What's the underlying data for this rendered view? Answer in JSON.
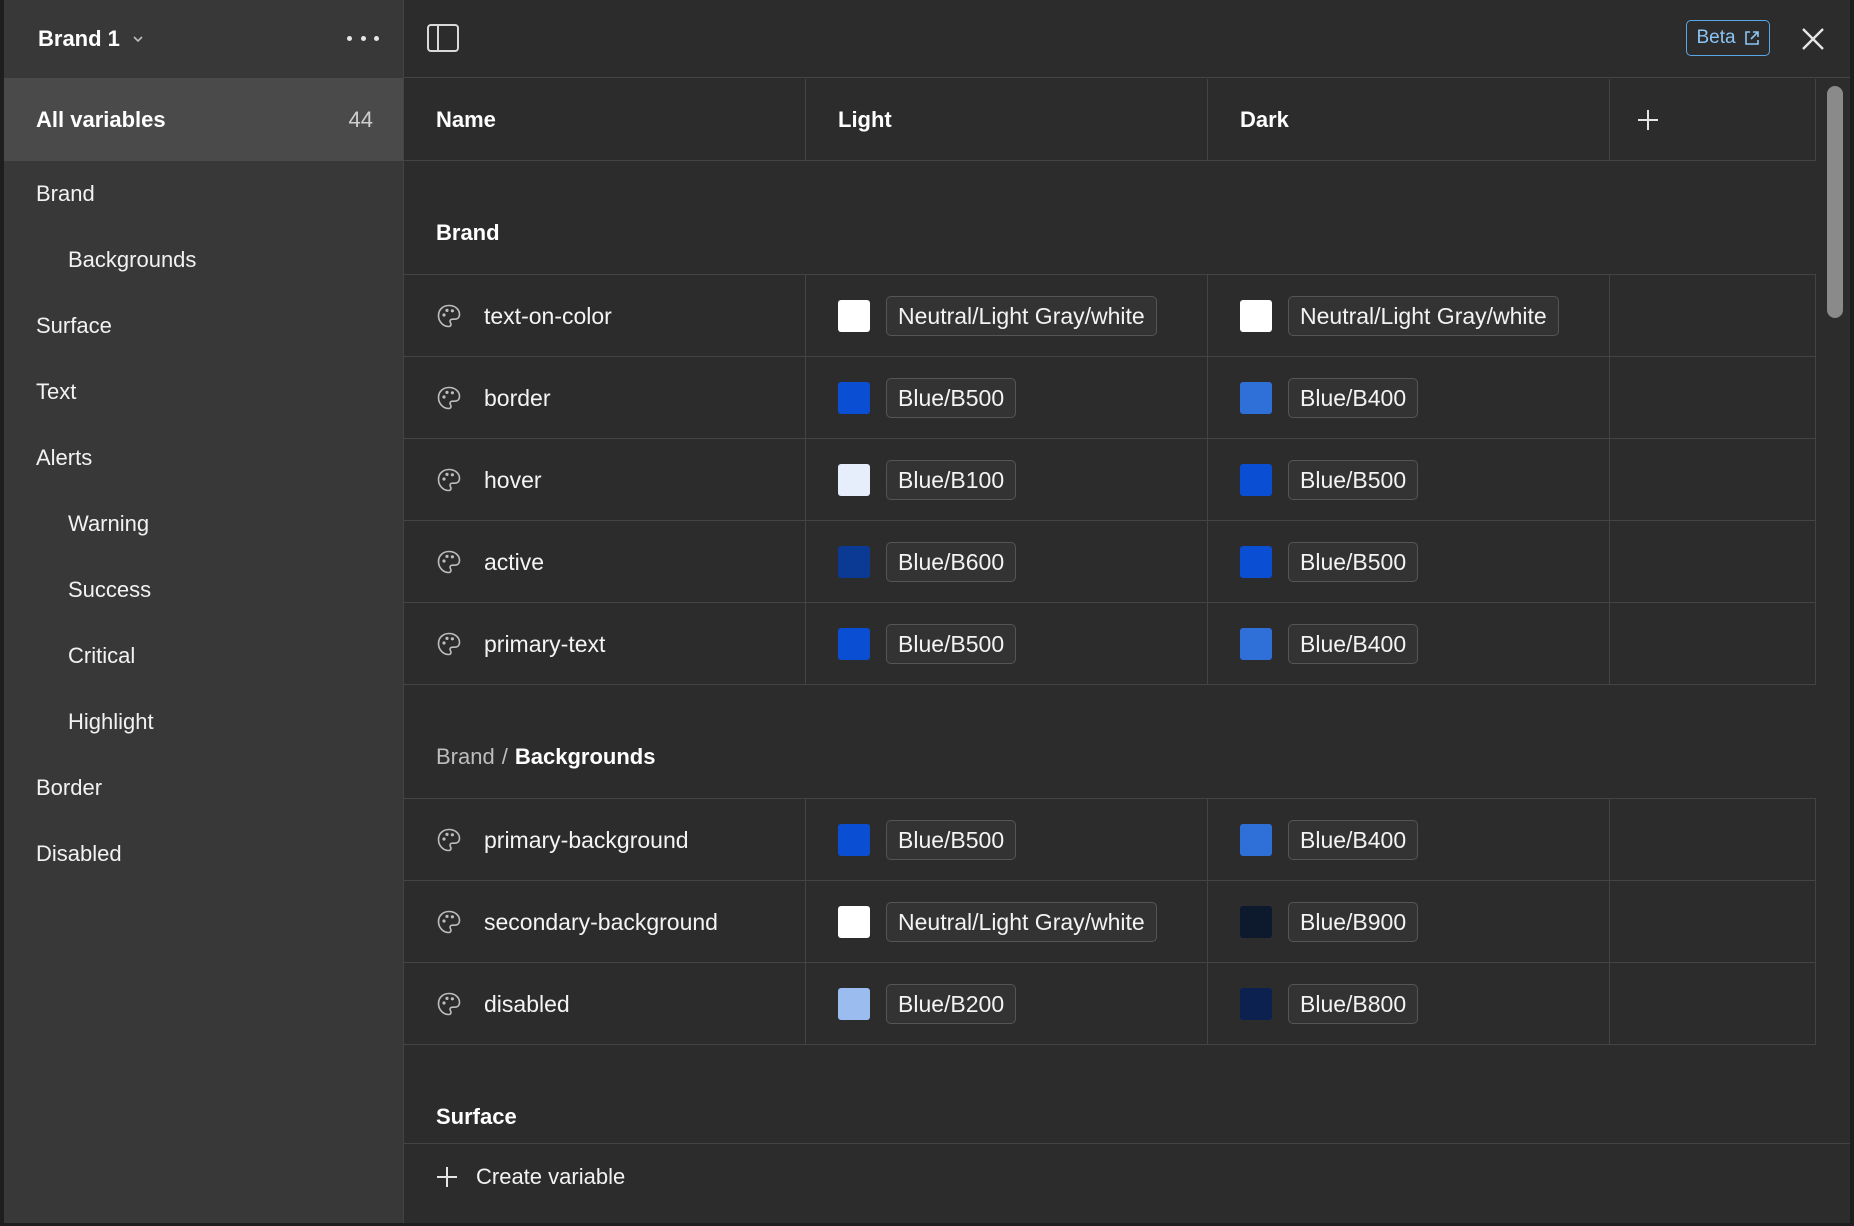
{
  "sidebar": {
    "collection_name": "Brand 1",
    "all_variables": {
      "label": "All variables",
      "count": "44"
    },
    "groups": [
      {
        "label": "Brand",
        "level": 0
      },
      {
        "label": "Backgrounds",
        "level": 1
      },
      {
        "label": "Surface",
        "level": 0
      },
      {
        "label": "Text",
        "level": 0
      },
      {
        "label": "Alerts",
        "level": 0
      },
      {
        "label": "Warning",
        "level": 1
      },
      {
        "label": "Success",
        "level": 1
      },
      {
        "label": "Critical",
        "level": 1
      },
      {
        "label": "Highlight",
        "level": 1
      },
      {
        "label": "Border",
        "level": 0
      },
      {
        "label": "Disabled",
        "level": 0
      }
    ]
  },
  "topbar": {
    "beta_label": "Beta"
  },
  "table": {
    "columns": {
      "name": "Name",
      "light": "Light",
      "dark": "Dark"
    },
    "groups": [
      {
        "parent": "",
        "title": "Brand",
        "rows": [
          {
            "name": "text-on-color",
            "light": {
              "value": "Neutral/Light Gray/white",
              "color": "#ffffff"
            },
            "dark": {
              "value": "Neutral/Light Gray/white",
              "color": "#ffffff"
            }
          },
          {
            "name": "border",
            "light": {
              "value": "Blue/B500",
              "color": "#0a4fd3"
            },
            "dark": {
              "value": "Blue/B400",
              "color": "#2e6fd8"
            }
          },
          {
            "name": "hover",
            "light": {
              "value": "Blue/B100",
              "color": "#e6edfb"
            },
            "dark": {
              "value": "Blue/B500",
              "color": "#0a4fd3"
            }
          },
          {
            "name": "active",
            "light": {
              "value": "Blue/B600",
              "color": "#0b3a94"
            },
            "dark": {
              "value": "Blue/B500",
              "color": "#0a4fd3"
            }
          },
          {
            "name": "primary-text",
            "light": {
              "value": "Blue/B500",
              "color": "#0a4fd3"
            },
            "dark": {
              "value": "Blue/B400",
              "color": "#2e6fd8"
            }
          }
        ]
      },
      {
        "parent": "Brand",
        "separator": "/",
        "title": "Backgrounds",
        "rows": [
          {
            "name": "primary-background",
            "light": {
              "value": "Blue/B500",
              "color": "#0a4fd3"
            },
            "dark": {
              "value": "Blue/B400",
              "color": "#2e6fd8"
            }
          },
          {
            "name": "secondary-background",
            "light": {
              "value": "Neutral/Light Gray/white",
              "color": "#ffffff"
            },
            "dark": {
              "value": "Blue/B900",
              "color": "#0d1a2e"
            }
          },
          {
            "name": "disabled",
            "light": {
              "value": "Blue/B200",
              "color": "#9bbcef"
            },
            "dark": {
              "value": "Blue/B800",
              "color": "#0d2150"
            }
          }
        ]
      },
      {
        "parent": "",
        "title": "Surface",
        "rows": []
      }
    ]
  },
  "footer": {
    "create_label": "Create variable"
  },
  "icons": {
    "variable": "palette-icon",
    "add_mode": "plus-icon",
    "close": "close-icon",
    "panel": "sidebar-toggle-icon",
    "external": "external-link-icon",
    "more": "more-horizontal-icon",
    "chevron": "chevron-down-icon"
  }
}
